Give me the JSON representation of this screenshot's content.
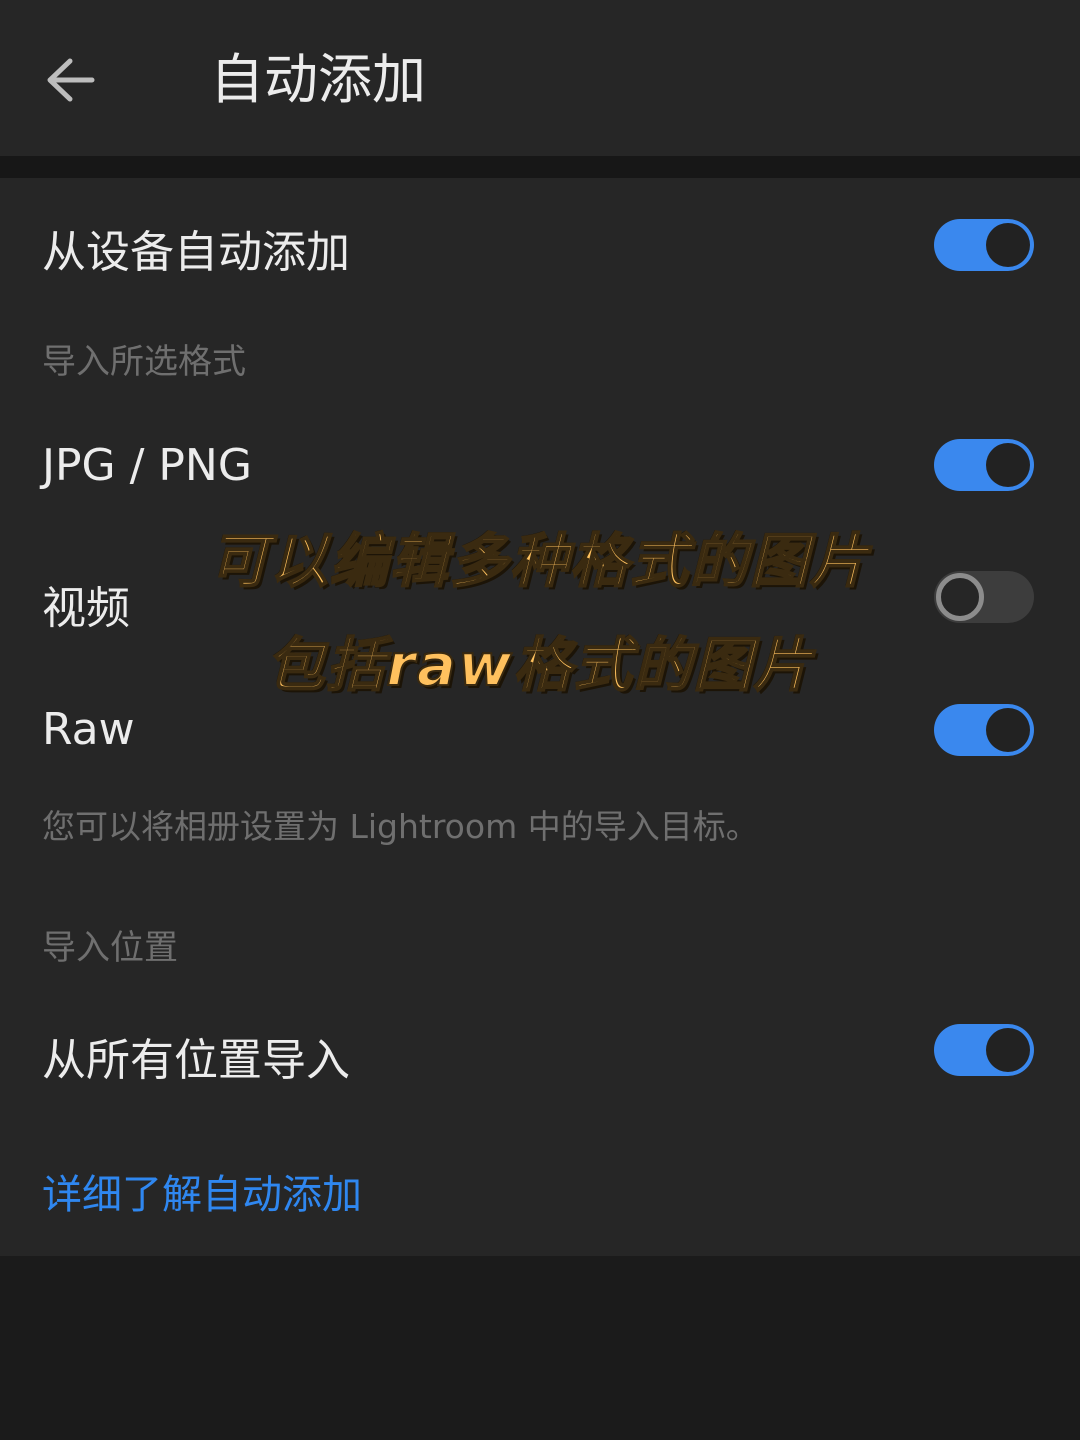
{
  "header": {
    "back_icon": "arrow-left-icon",
    "title": "自动添加"
  },
  "settings": {
    "auto_add_from_device": {
      "label": "从设备自动添加",
      "enabled": true
    },
    "import_formats_section": "导入所选格式",
    "jpg_png": {
      "label": "JPG / PNG",
      "enabled": true
    },
    "video": {
      "label": "视频",
      "enabled": false
    },
    "raw": {
      "label": "Raw",
      "enabled": true
    },
    "album_note": "您可以将相册设置为 Lightroom 中的导入目标。",
    "import_location_section": "导入位置",
    "import_all_locations": {
      "label": "从所有位置导入",
      "enabled": true
    },
    "learn_more_link": "详细了解自动添加"
  },
  "overlay": {
    "line1": "可以编辑多种格式的图片",
    "line2": "包括raw格式的图片"
  },
  "colors": {
    "toggle_on": "#3a88ee",
    "link": "#2f87f0",
    "overlay_text": "#ffc15e"
  }
}
